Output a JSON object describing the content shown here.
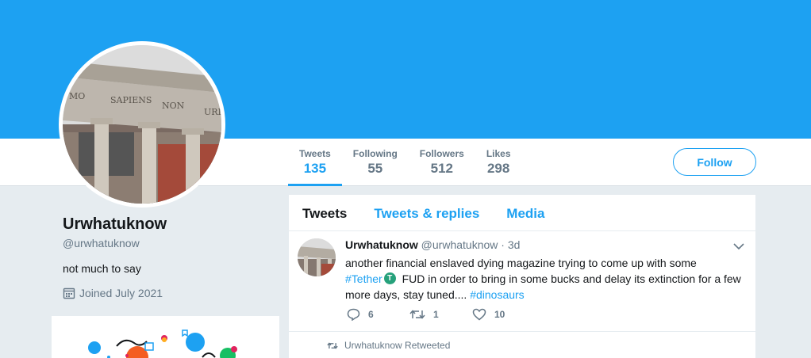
{
  "nav": {
    "stats": [
      {
        "label": "Tweets",
        "value": "135"
      },
      {
        "label": "Following",
        "value": "55"
      },
      {
        "label": "Followers",
        "value": "512"
      },
      {
        "label": "Likes",
        "value": "298"
      }
    ],
    "follow_label": "Follow"
  },
  "profile": {
    "name": "Urwhatuknow",
    "handle": "@urwhatuknow",
    "bio": "not much to say",
    "joined": "Joined July 2021",
    "avatar_inscription": [
      "MO",
      "SAPIENS",
      "NON",
      "URIN"
    ]
  },
  "timeline": {
    "tabs": [
      "Tweets",
      "Tweets & replies",
      "Media"
    ],
    "tweet": {
      "name": "Urwhatuknow",
      "handle": "@urwhatuknow",
      "time": "· 3d",
      "text_1": "another financial enslaved dying magazine trying to come up with some",
      "hashtag_1": "#Tether",
      "text_2": " FUD in order to bring in some bucks and delay its extinction for a few more days, stay tuned.... ",
      "hashtag_2": "#dinosaurs",
      "replies": "6",
      "retweets": "1",
      "likes": "10"
    },
    "retweeted_label": "Urwhatuknow Retweeted"
  },
  "colors": {
    "accent": "#1da1f2",
    "tether": "#26a17b"
  }
}
